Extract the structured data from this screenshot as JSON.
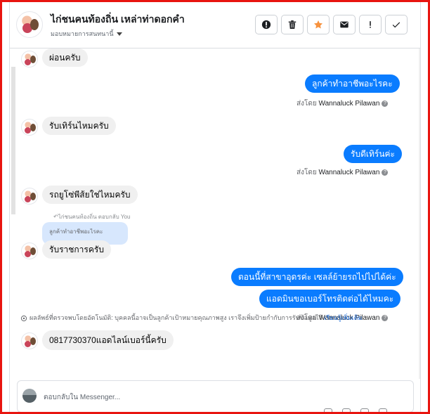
{
  "header": {
    "title": "ไก่ชนคนท้องถิ่น เหล่าท่าดอกคำ",
    "assign_label": "มอบหมายการสนทนานี้",
    "actions": [
      {
        "name": "mark-unread-icon",
        "label": "Mark as unread"
      },
      {
        "name": "trash-icon",
        "label": "Delete"
      },
      {
        "name": "star-icon",
        "label": "Star"
      },
      {
        "name": "envelope-icon",
        "label": "Email"
      },
      {
        "name": "exclamation-icon",
        "label": "Spam"
      },
      {
        "name": "check-icon",
        "label": "Done"
      }
    ]
  },
  "messages": {
    "m1": "ผ่อนครับ",
    "m2": "ลูกค้าทำอาชีพอะไรคะ",
    "m3": "รับเทิร์นไหมครับ",
    "m4": "รับดีเทิร์นค่ะ",
    "m5": "รถยูโซ่พีส้ยใช่ไหมครับ",
    "m6_reply_note": "↶ไก่ชนคนท้องถิ่น ตอบกลับ You",
    "m6_quoted": "ลูกค้าทำอาชีพอะไรคะ",
    "m6": "รับราชการครับ",
    "m7": "ตอนนี้ที่สาขาอุดรค่ะ เซลล์ย้ายรถไปไปได้ค่ะ",
    "m8": "แอดมินขอเบอร์โทรติดต่อได้ไหมคะ",
    "m9": "0817730370แอดไลน์เบอร์นี้ครับ"
  },
  "sent_by": {
    "prefix": "ส่งโดย",
    "agent": "Wannaluck Pilawan",
    "help": "?"
  },
  "ai_note": {
    "text": "ผลลัพธ์ที่ตรวจพบโดยอัตโนมัติ: บุคคลนี้อาจเป็นลูกค้าเป้าหมายคุณภาพสูง เราจึงเพิ่มป้ายกำกับการรับข้อมูลไว้",
    "link": "เรียนรู้เพิ่มเติม"
  },
  "composer": {
    "placeholder": "ตอบกลับใน Messenger..."
  },
  "colors": {
    "frame": "#e8140f",
    "outgoing_bubble": "#0a7cff",
    "incoming_bubble": "#f0f0f0",
    "quoted_bubble": "#d7e7fd",
    "star": "#f7923e"
  }
}
